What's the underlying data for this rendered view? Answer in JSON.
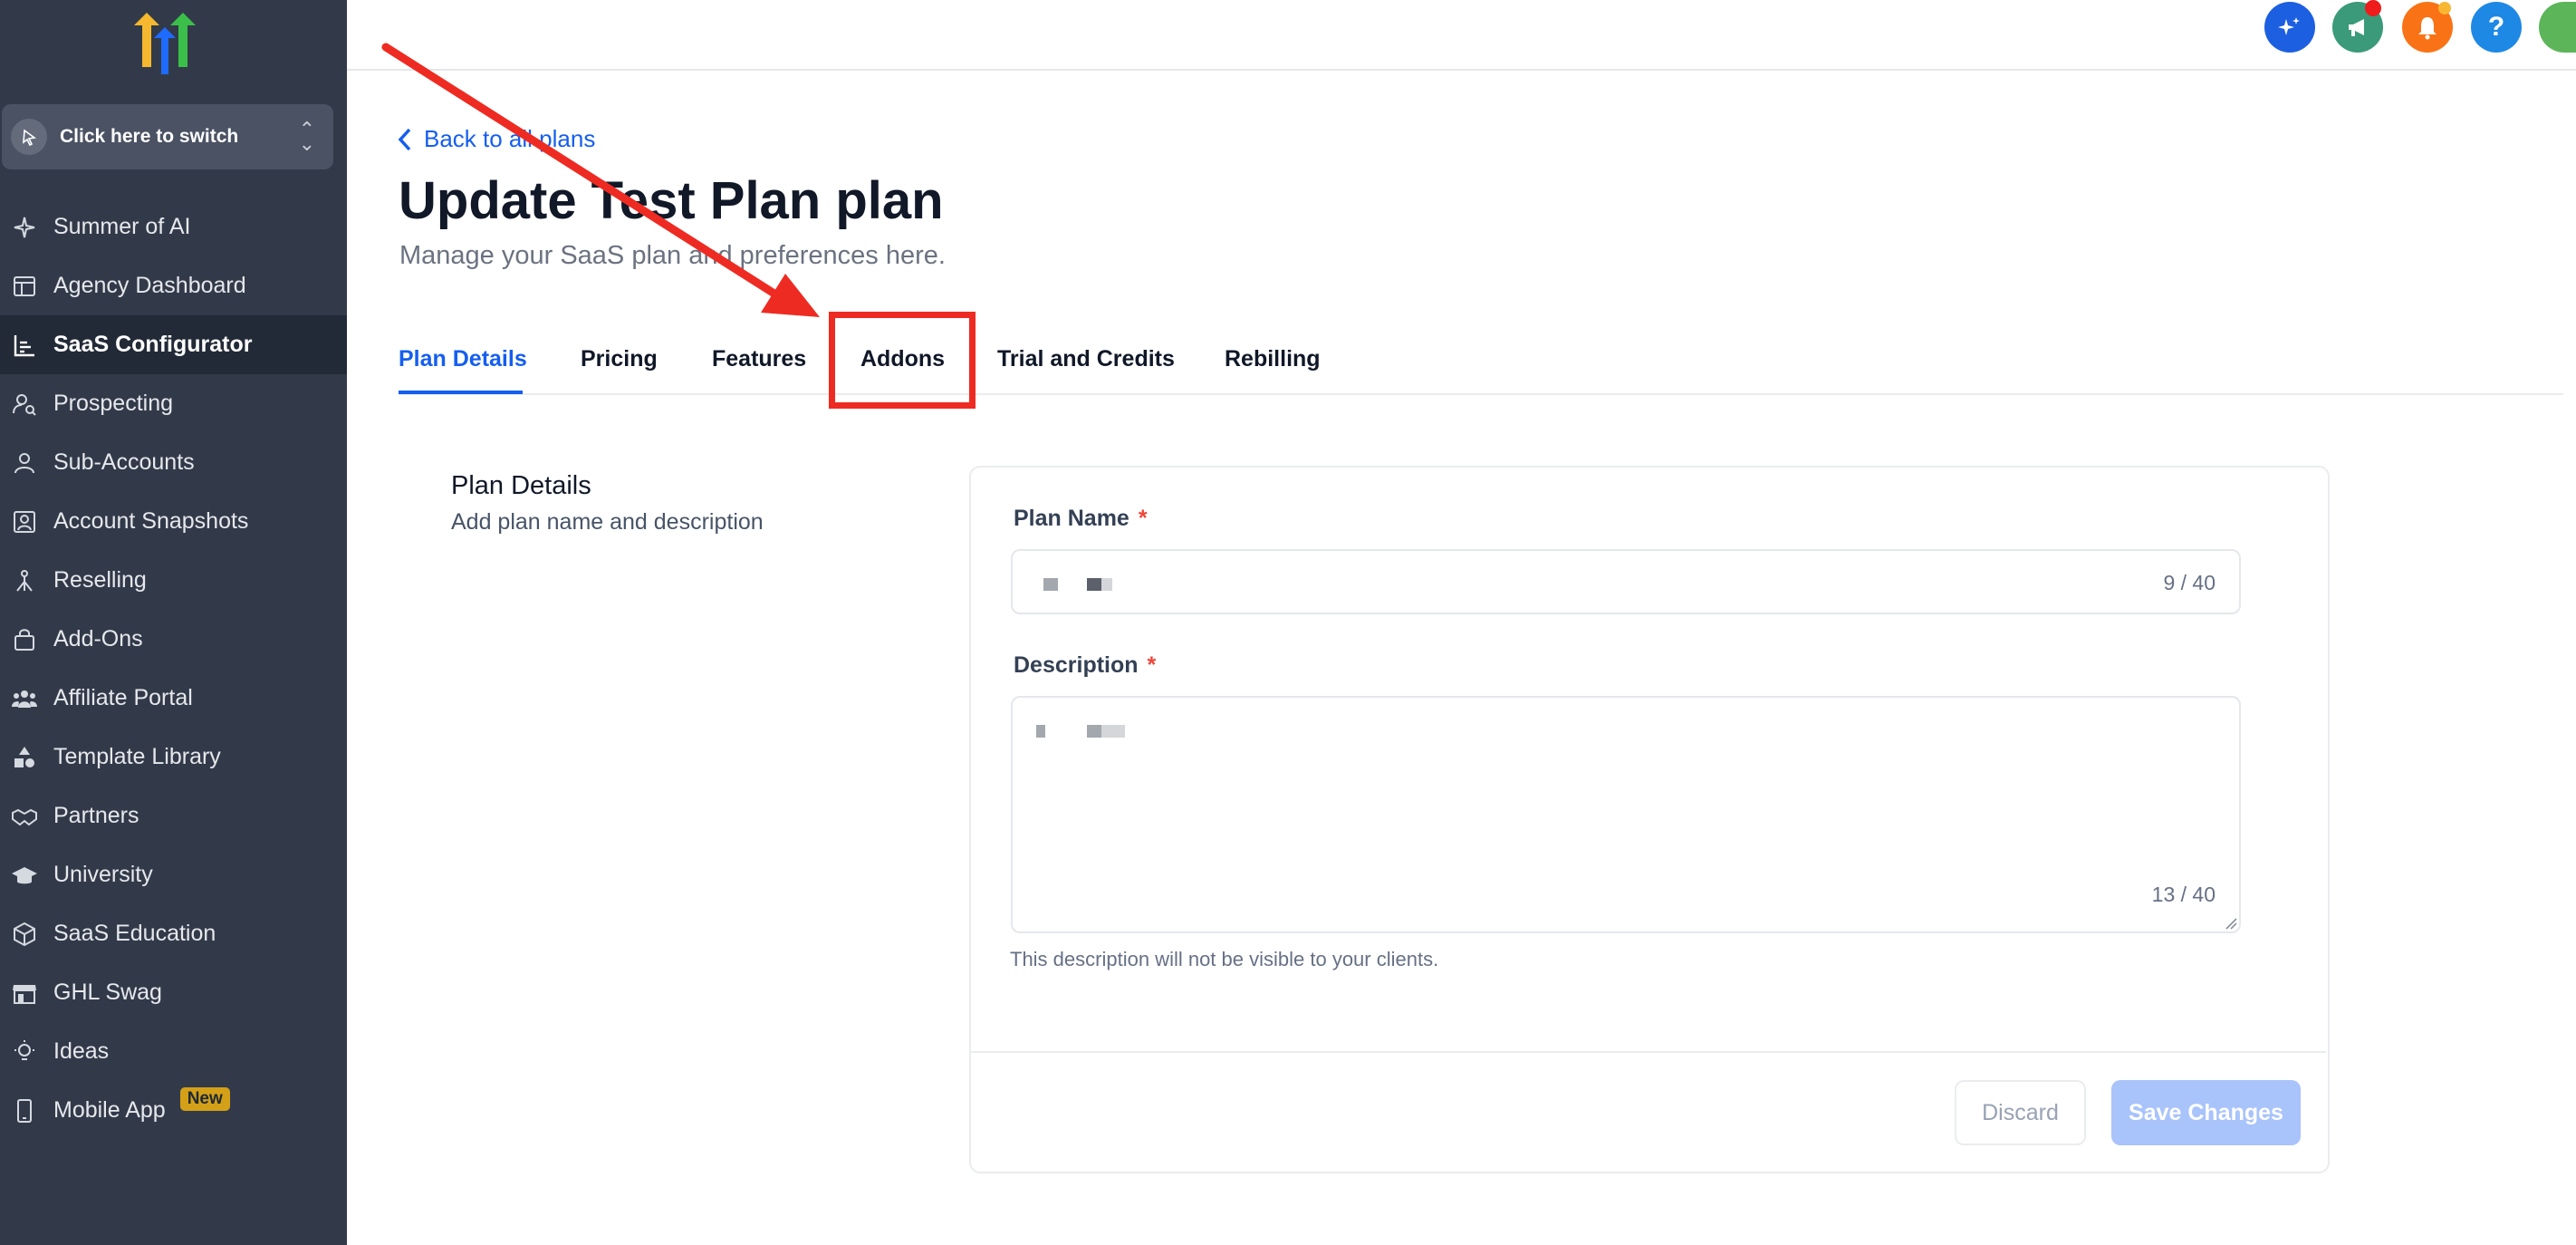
{
  "sidebar": {
    "switcher_label": "Click here to switch",
    "items": [
      {
        "label": "Summer of AI",
        "icon": "sparkle-icon"
      },
      {
        "label": "Agency Dashboard",
        "icon": "dashboard-icon"
      },
      {
        "label": "SaaS Configurator",
        "icon": "bar-chart-icon",
        "active": true
      },
      {
        "label": "Prospecting",
        "icon": "user-search-icon"
      },
      {
        "label": "Sub-Accounts",
        "icon": "user-icon"
      },
      {
        "label": "Account Snapshots",
        "icon": "snapshot-icon"
      },
      {
        "label": "Reselling",
        "icon": "reselling-icon"
      },
      {
        "label": "Add-Ons",
        "icon": "bag-icon"
      },
      {
        "label": "Affiliate Portal",
        "icon": "users-icon"
      },
      {
        "label": "Template Library",
        "icon": "shapes-icon"
      },
      {
        "label": "Partners",
        "icon": "handshake-icon"
      },
      {
        "label": "University",
        "icon": "graduation-cap-icon"
      },
      {
        "label": "SaaS Education",
        "icon": "cube-icon"
      },
      {
        "label": "GHL Swag",
        "icon": "store-icon"
      },
      {
        "label": "Ideas",
        "icon": "lightbulb-icon"
      },
      {
        "label": "Mobile App",
        "icon": "mobile-icon",
        "badge": "New"
      }
    ]
  },
  "topbar": {
    "buttons": [
      {
        "icon": "ai-sparkle-icon",
        "color": "#1c5fe0"
      },
      {
        "icon": "megaphone-icon",
        "color": "#3a9a7a"
      },
      {
        "icon": "bell-icon",
        "color": "#f97316"
      },
      {
        "icon": "help-icon",
        "color": "#1e88e5",
        "glyph": "?"
      }
    ]
  },
  "main": {
    "back_label": "Back to all plans",
    "title": "Update Test Plan plan",
    "subtitle": "Manage your SaaS plan and preferences here.",
    "tabs": [
      "Plan Details",
      "Pricing",
      "Features",
      "Addons",
      "Trial and Credits",
      "Rebilling"
    ],
    "active_tab": "Plan Details",
    "highlighted_tab": "Addons",
    "section": {
      "title": "Plan Details",
      "subtitle": "Add plan name and description"
    },
    "form": {
      "plan_name_label": "Plan Name",
      "plan_name_counter": "9 / 40",
      "description_label": "Description",
      "description_counter": "13 / 40",
      "required_mark": "*",
      "help_text": "This description will not be visible to your clients.",
      "discard_label": "Discard",
      "save_label": "Save Changes"
    }
  },
  "colors": {
    "sidebar_bg": "#323a4a",
    "accent": "#155eef",
    "annotation_red": "#ee2b22"
  }
}
